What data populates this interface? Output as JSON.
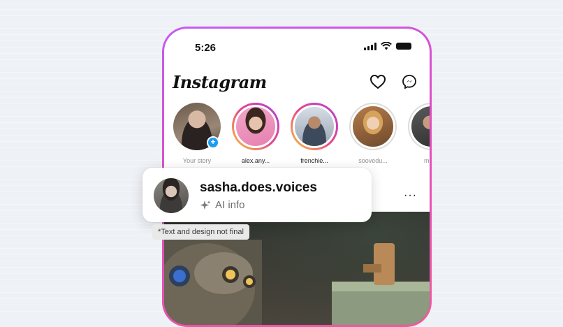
{
  "status_bar": {
    "time": "5:26"
  },
  "header": {
    "logo": "Instagram",
    "icons": [
      "heart-icon",
      "messenger-icon"
    ]
  },
  "stories": [
    {
      "label": "Your story",
      "ring": "none",
      "add_badge": "+"
    },
    {
      "label": "alex.any...",
      "ring": "new"
    },
    {
      "label": "frenchie...",
      "ring": "new"
    },
    {
      "label": "soovedu...",
      "ring": "seen"
    },
    {
      "label": "mech",
      "ring": "seen"
    }
  ],
  "post": {
    "more_label": "···"
  },
  "card": {
    "username": "sasha.does.voices",
    "ai_label": "AI info",
    "ai_icon": "sparkle-icon"
  },
  "disclaimer": "*Text and design not final",
  "colors": {
    "phone_border": "#d94fd0",
    "story_ring_new": "#e5468a",
    "add_badge": "#1d9bf0"
  }
}
